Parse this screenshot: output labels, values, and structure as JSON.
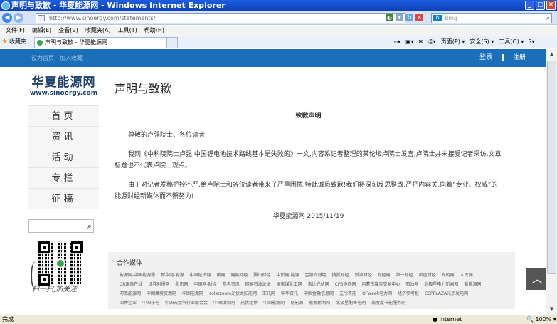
{
  "window": {
    "title": "声明与致歉 - 华夏能源网 - Windows Internet Explorer",
    "min": "_",
    "max": "□",
    "close": "✕"
  },
  "address": {
    "url": "http://www.sinoergy.com/statements/",
    "search_placeholder": "Bing",
    "search_brand": "b"
  },
  "menu": [
    "文件(F)",
    "编辑(E)",
    "查看(V)",
    "收藏夹(A)",
    "工具(T)",
    "帮助(H)"
  ],
  "favbar": {
    "favorites": "收藏夹",
    "tab": "声明与致歉 - 华夏能源网",
    "tools": [
      "页面(P) ▾",
      "安全(S) ▾",
      "工具(O) ▾"
    ]
  },
  "topnav": {
    "left": [
      "设为首页",
      "加入收藏"
    ],
    "login": "登录",
    "register": "注册"
  },
  "site": {
    "name": "华夏能源网",
    "domain": "www.sinoergy.com",
    "nav": [
      "首页",
      "资讯",
      "活动",
      "专栏",
      "征稿"
    ],
    "slogan": "扫一扫,加关注"
  },
  "article": {
    "page_title": "声明与致歉",
    "heading": "致歉声明",
    "greeting": "尊敬的卢强院士、各位读者:",
    "p1": "我网《中科院院士卢强,中国锂电池技术路线基本是失败的》一文,内容系记者整理的某论坛卢院士发言,卢院士并未接受记者采访,文章标题也不代表卢院士观点。",
    "p2": "由于对记者发稿把控不严,给卢院士和各位读者带来了严重困扰,特此诚恳致歉!我们将深刻反思整改,严把内容关,向着“专业、权威”的能源财经新媒体而不懈努力!",
    "sign": "华夏能源网 2015/11/19"
  },
  "partners": {
    "title": "合作媒体",
    "links": [
      "能源网-中国能源报",
      "新华网-能源",
      "中国经济网",
      "黄网",
      "网易财经",
      "腾讯财经",
      "中新网-能源",
      "金银岛财经",
      "搜狐财经",
      "新浪财经",
      "财经网",
      "第一财经",
      "凤凰财经",
      "光明网",
      "人民网",
      "CR国际在线",
      "证券时报网",
      "和讯网",
      "中国网-财经",
      "参考资讯",
      "网易石油论坛",
      "国家煤化工网",
      "索比光伏网",
      "CFB协作网",
      "内蒙古煤炭交易中心",
      "石油网",
      "北极星电力新闻网",
      "新能源网",
      "河南能源网",
      "中国煤炭资源网",
      "中国能源网",
      "solarzoom光伏太阳能网",
      "亚讯网",
      "中华资讯",
      "中国金融信息网",
      "无所不能",
      "OFweek电力网",
      "经济参考报",
      "CSPPLAZA光热发电网",
      "国博企业",
      "中国核电",
      "中国天然气行业联合会",
      "中国煤炭网",
      "光伏组件",
      "中国能源网",
      "易能源",
      "能源新闻网",
      "北极星配售电网",
      "南度度节能服务网"
    ]
  },
  "status": {
    "left": "完成",
    "zone": "Internet",
    "zoom": "100%"
  }
}
